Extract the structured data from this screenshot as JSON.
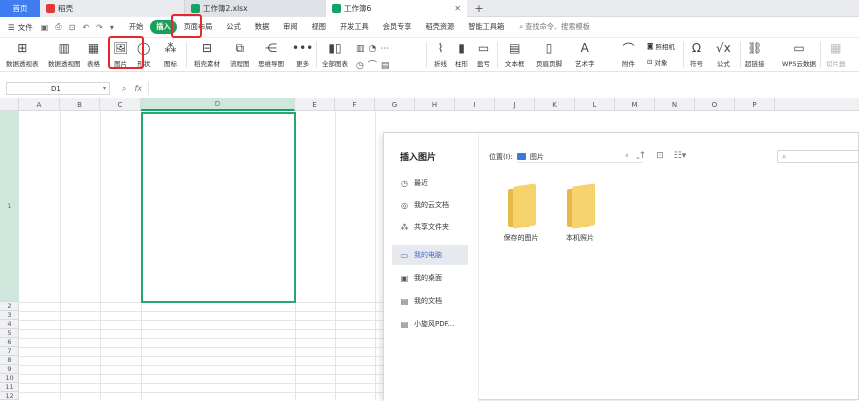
{
  "tabs": {
    "home": "首页",
    "docer": "稻壳",
    "workbook2": "工作簿2.xlsx",
    "workbook6": "工作簿6",
    "add": "+"
  },
  "menu": {
    "file": "文件",
    "tabs": [
      "开始",
      "插入",
      "页面布局",
      "公式",
      "数据",
      "审阅",
      "视图",
      "开发工具",
      "会员专享",
      "稻壳资源",
      "智能工具箱"
    ],
    "active_tab": "插入",
    "search": "查找命令、搜索模板"
  },
  "ribbon": {
    "pivot_table": "数据透视表",
    "pivot_chart": "数据透视图",
    "table": "表格",
    "picture": "图片",
    "shapes": "形状",
    "icons": "图标",
    "docer_material": "稻壳素材",
    "flowchart": "流程图",
    "mindmap": "思维导图",
    "more": "更多",
    "all_charts": "全部图表",
    "sparkline_line": "折线",
    "sparkline_column": "柱形",
    "sparkline_winloss": "盈亏",
    "textbox": "文本框",
    "header_footer": "页眉页脚",
    "wordart": "艺术字",
    "attachment": "附件",
    "camera": "照相机",
    "object": "对象",
    "symbol": "符号",
    "equation": "公式",
    "hyperlink": "超链接",
    "wps_form": "WPS云数据",
    "slicer": "切片器"
  },
  "formula": {
    "cell": "D1",
    "fx": "fx",
    "value": ""
  },
  "sheet": {
    "columns": [
      "A",
      "B",
      "C",
      "D",
      "E",
      "F",
      "G",
      "H",
      "I",
      "J",
      "K",
      "L",
      "M",
      "N",
      "O",
      "P"
    ],
    "selected_column": "D",
    "rows": [
      "1",
      "2",
      "3",
      "4",
      "5",
      "6",
      "7",
      "8",
      "9",
      "10",
      "11",
      "12"
    ]
  },
  "dialog": {
    "title": "插入图片",
    "nav": [
      "最近",
      "我的云文档",
      "共享文件夹",
      "我的电脑",
      "我的桌面",
      "我的文档",
      "小旋风PDF..."
    ],
    "selected_nav": "我的电脑",
    "location_label": "位置(I):",
    "location_value": "图片",
    "search_placeholder": "",
    "folders": [
      "保存的图片",
      "本机照片"
    ]
  }
}
